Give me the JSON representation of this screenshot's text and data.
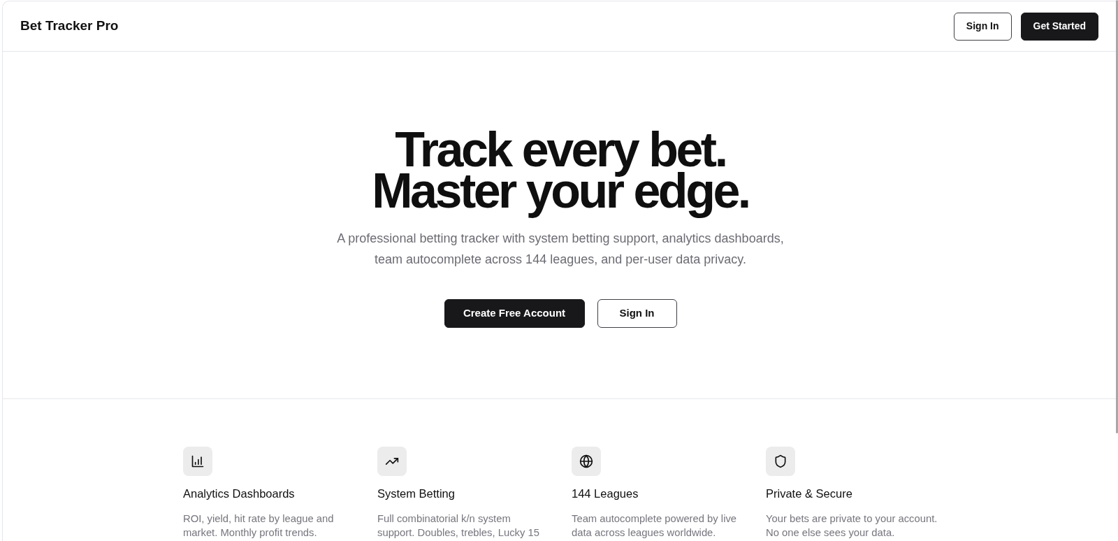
{
  "header": {
    "logo": "Bet Tracker Pro",
    "buttons": [
      {
        "label": "Sign In",
        "kind": "outline"
      },
      {
        "label": "Get Started",
        "kind": "solid"
      }
    ]
  },
  "hero": {
    "title_lines": [
      "Track every bet.",
      "Master your edge."
    ],
    "subtitle": "A professional betting tracker with system betting support, analytics dashboards, team autocomplete across 144 leagues, and per-user data privacy.",
    "buttons": [
      {
        "label": "Create Free Account",
        "kind": "solid"
      },
      {
        "label": "Sign In",
        "kind": "outline"
      }
    ]
  },
  "features": [
    {
      "title": "Analytics Dashboards",
      "description": "ROI, yield, hit rate by league and market. Monthly profit trends."
    },
    {
      "title": "System Betting",
      "description": "Full combinatorial k/n system support. Doubles, trebles, Lucky 15"
    },
    {
      "title": "144 Leagues",
      "description": "Team autocomplete powered by live data across leagues worldwide."
    },
    {
      "title": "Private & Secure",
      "description": "Your bets are private to your account. No one else sees your data."
    }
  ]
}
